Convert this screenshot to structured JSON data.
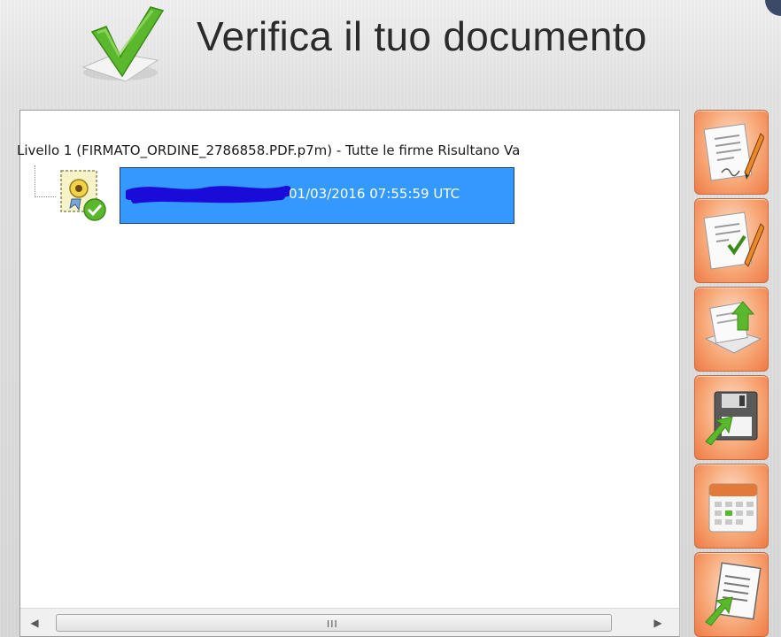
{
  "header": {
    "title": "Verifica il tuo documento"
  },
  "tree": {
    "level_text": "Livello 1 (FIRMATO_ORDINE_2786858.PDF.p7m) - Tutte le firme Risultano Va",
    "signature_node": {
      "date_text": "01/03/2016 07:55:59 UTC",
      "icon": "signed-certificate-icon",
      "selected": true
    }
  },
  "scrollbar": {
    "grip_text": "III"
  },
  "toolbar": {
    "buttons": [
      {
        "icon": "sign-document-icon"
      },
      {
        "icon": "verify-signature-icon"
      },
      {
        "icon": "open-document-icon"
      },
      {
        "icon": "save-floppy-icon"
      },
      {
        "icon": "calendar-icon"
      },
      {
        "icon": "export-document-icon"
      }
    ]
  },
  "colors": {
    "selection": "#3399ff",
    "toolbar_orange": "#ee7a45",
    "check_green": "#5bb82d"
  }
}
